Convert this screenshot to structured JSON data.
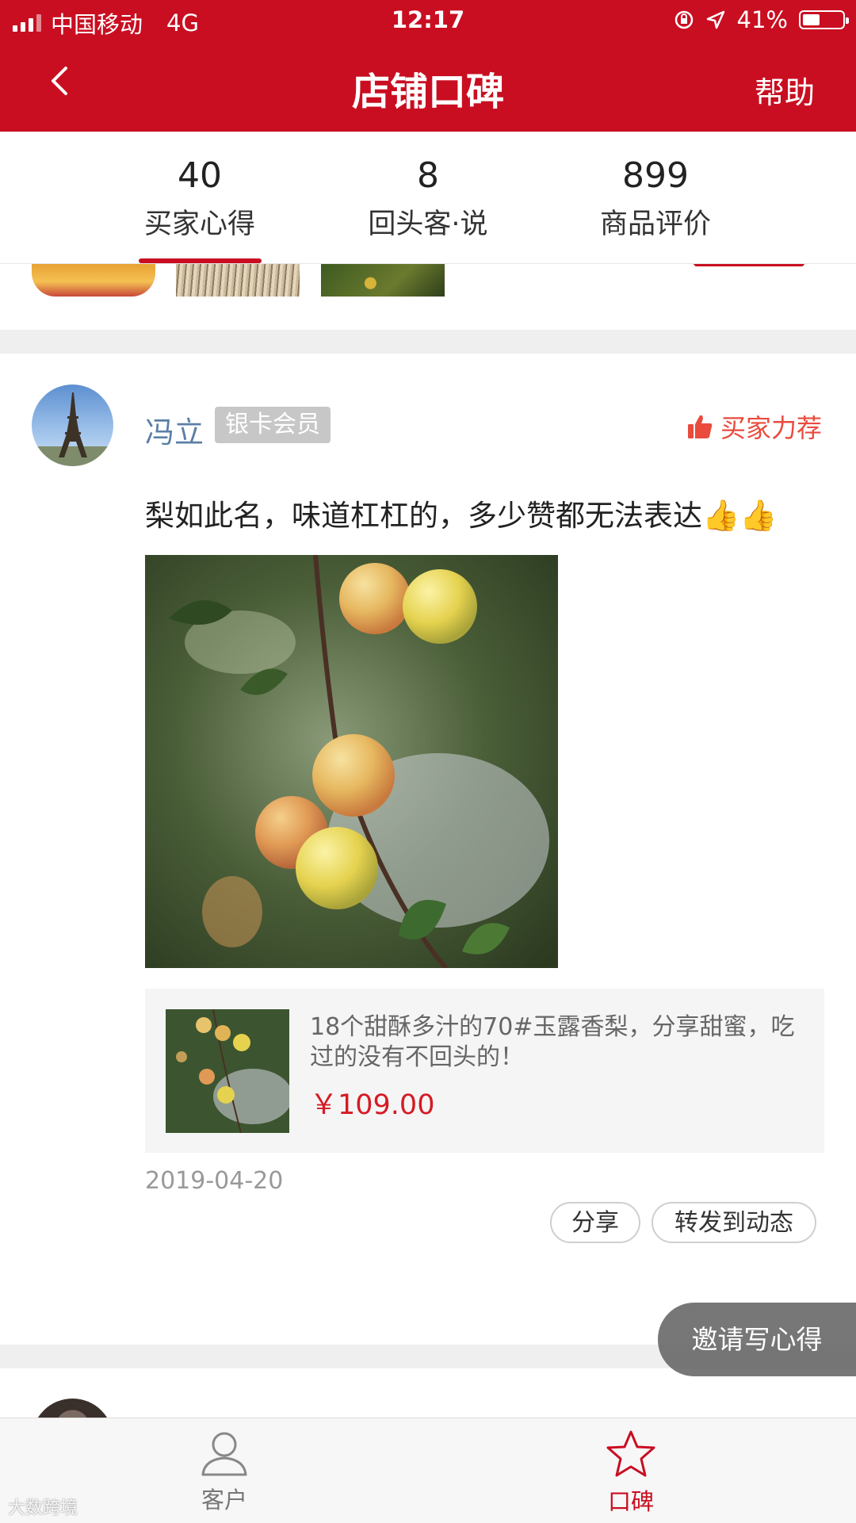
{
  "status_bar": {
    "carrier": "中国移动",
    "network": "4G",
    "time": "12:17",
    "battery": "41%"
  },
  "header": {
    "title": "店铺口碑",
    "help_label": "帮助"
  },
  "stats_tabs": [
    {
      "count": "40",
      "label": "买家心得",
      "active": true
    },
    {
      "count": "8",
      "label": "回头客·说",
      "active": false
    },
    {
      "count": "899",
      "label": "商品评价",
      "active": false
    }
  ],
  "post": {
    "author": "冯立",
    "member_badge": "银卡会员",
    "recommend_label": "买家力荐",
    "text": "梨如此名，味道杠杠的，多少赞都无法表达",
    "emojis": "👍👍",
    "product": {
      "title": "18个甜酥多汁的70#玉露香梨，分享甜蜜，吃过的没有不回头的！",
      "price": "￥109.00"
    },
    "date": "2019-04-20",
    "share_label": "分享",
    "forward_label": "转发到动态"
  },
  "floating_button": {
    "label": "邀请写心得"
  },
  "bottom_tabs": [
    {
      "label": "客户",
      "icon": "person-icon",
      "active": false
    },
    {
      "label": "口碑",
      "icon": "star-icon",
      "active": true
    }
  ],
  "watermark": "大数跨境",
  "colors": {
    "brand_red": "#c90e21",
    "author_blue": "#5b7fa6",
    "price_red": "#d61a25",
    "recommend_red": "#e94b3d"
  }
}
